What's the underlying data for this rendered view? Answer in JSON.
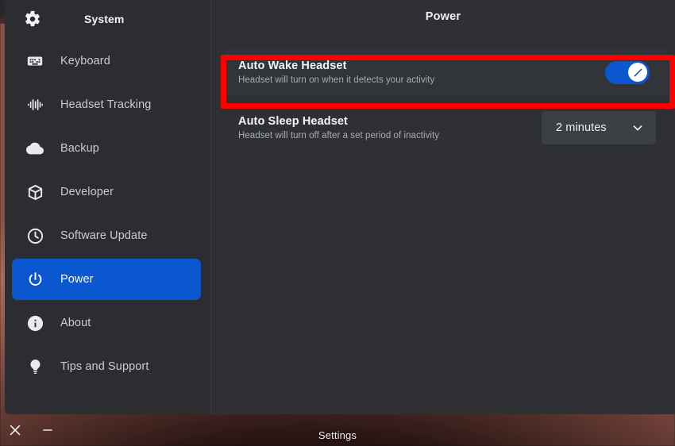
{
  "window": {
    "app_name": "Settings"
  },
  "sidebar": {
    "header": {
      "icon": "gear-icon",
      "title": "System"
    },
    "items": [
      {
        "label": "Keyboard",
        "icon": "keyboard-icon",
        "selected": false
      },
      {
        "label": "Headset Tracking",
        "icon": "waveform-icon",
        "selected": false
      },
      {
        "label": "Backup",
        "icon": "cloud-icon",
        "selected": false
      },
      {
        "label": "Developer",
        "icon": "box-icon",
        "selected": false
      },
      {
        "label": "Software Update",
        "icon": "clock-icon",
        "selected": false
      },
      {
        "label": "Power",
        "icon": "power-icon",
        "selected": true
      },
      {
        "label": "About",
        "icon": "info-icon",
        "selected": false
      },
      {
        "label": "Tips and Support",
        "icon": "lightbulb-icon",
        "selected": false
      }
    ]
  },
  "main": {
    "title": "Power",
    "rows": [
      {
        "title": "Auto Wake Headset",
        "subtitle": "Headset will turn on when it detects your activity",
        "control": "toggle",
        "toggle_state": "on",
        "highlighted": true
      },
      {
        "title": "Auto Sleep Headset",
        "subtitle": "Headset will turn off after a set period of inactivity",
        "control": "dropdown",
        "dropdown_value": "2 minutes"
      }
    ]
  },
  "taskbar": {
    "close_label": "×",
    "minimize_label": "−",
    "title": "Settings"
  },
  "colors": {
    "accent_blue": "#0b57d0",
    "highlight_red": "#ff0000",
    "window_bg": "#2e3034",
    "sidebar_bg": "#2b2d31",
    "card_bg": "#313438",
    "dropdown_bg": "#3c4045"
  }
}
